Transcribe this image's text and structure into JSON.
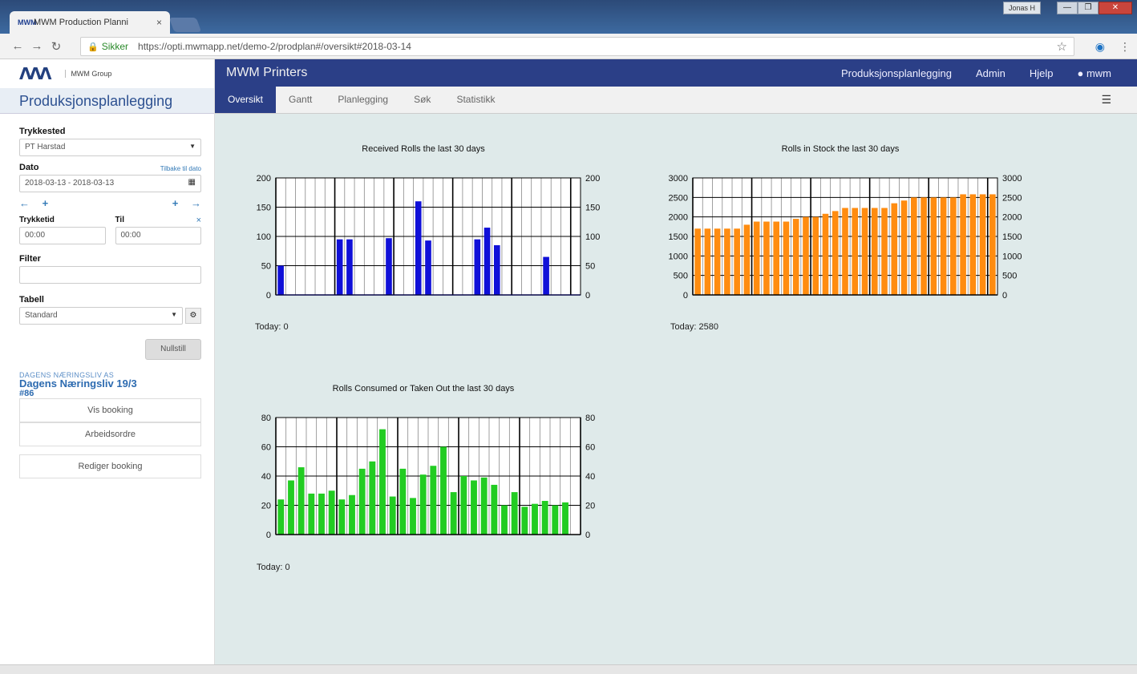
{
  "browser": {
    "tab_title": "MWM Production Planni",
    "tab_close": "×",
    "profile": "Jonas H",
    "secure_label": "Sikker",
    "url": "https://opti.mwmapp.net/demo-2/prodplan#/oversikt#2018-03-14",
    "back": "←",
    "forward": "→",
    "reload": "↻",
    "star": "☆",
    "menu": "⋮",
    "lock_icon": "🔒",
    "min": "—",
    "max": "❐",
    "close": "✕"
  },
  "sidebar": {
    "logo_mark": "MWM",
    "logo_sub": "MWM Group",
    "app_title": "Produksjonsplanlegging",
    "trykkested_label": "Trykkested",
    "trykkested_value": "PT Harstad",
    "dato_label": "Dato",
    "dato_link": "Tilbake til dato",
    "dato_value": "2018-03-13 - 2018-03-13",
    "arrow_left": "←",
    "plus_left": "+",
    "plus_right": "+",
    "arrow_right": "→",
    "trykkeltid_label": "Trykketid",
    "til_label": "Til",
    "trykkeltid_value": "00:00",
    "til_value": "00:00",
    "clear": "×",
    "filter_label": "Filter",
    "filter_value": "",
    "tabell_label": "Tabell",
    "tabell_value": "Standard",
    "gear": "⚙",
    "nullstill": "Nullstill",
    "booking_caption": "DAGENS NÆRINGSLIV AS",
    "booking_name": "Dagens Næringsliv 19/3",
    "booking_number": "#86",
    "btn_vis_booking": "Vis booking",
    "btn_arbeidsordre": "Arbeidsordre",
    "btn_rediger": "Rediger booking"
  },
  "topnav": {
    "brand": "MWM Printers",
    "links": [
      "Produksjonsplanlegging",
      "Admin",
      "Hjelp",
      "mwm"
    ],
    "user_icon": "👤"
  },
  "subnav": {
    "tabs": [
      "Oversikt",
      "Gantt",
      "Planlegging",
      "Søk",
      "Statistikk"
    ],
    "menu_icon": "☰"
  },
  "charts": {
    "received_today": "Today: 0",
    "stock_today": "Today: 2580",
    "consumed_today": "Today: 0"
  },
  "chart_data": [
    {
      "type": "bar",
      "title": "Received Rolls the last 30 days",
      "color": "#1010d8",
      "ylim": [
        0,
        200
      ],
      "yticks": [
        0,
        50,
        100,
        150,
        200
      ],
      "values": [
        50,
        0,
        0,
        0,
        0,
        0,
        95,
        95,
        0,
        0,
        0,
        97,
        0,
        0,
        160,
        93,
        0,
        0,
        0,
        0,
        95,
        115,
        85,
        0,
        0,
        0,
        0,
        65,
        0,
        0,
        0
      ],
      "grid": true
    },
    {
      "type": "bar",
      "title": "Rolls in Stock the last 30 days",
      "color": "#ff8c10",
      "ylim": [
        0,
        3000
      ],
      "yticks": [
        0,
        500,
        1000,
        1500,
        2000,
        2500,
        3000
      ],
      "values": [
        1700,
        1700,
        1700,
        1700,
        1700,
        1800,
        1880,
        1880,
        1880,
        1880,
        1950,
        2000,
        2000,
        2080,
        2150,
        2230,
        2230,
        2230,
        2230,
        2230,
        2350,
        2420,
        2500,
        2500,
        2500,
        2500,
        2500,
        2580,
        2580,
        2580,
        2580
      ],
      "grid": true
    },
    {
      "type": "bar",
      "title": "Rolls Consumed or Taken Out the last 30 days",
      "color": "#22cc22",
      "ylim": [
        0,
        80
      ],
      "yticks": [
        0,
        20,
        40,
        60,
        80
      ],
      "values": [
        24,
        37,
        46,
        28,
        28,
        30,
        24,
        27,
        45,
        50,
        72,
        26,
        45,
        25,
        41,
        47,
        60,
        29,
        40,
        37,
        39,
        34,
        20,
        29,
        19,
        21,
        23,
        20,
        22,
        0
      ],
      "grid": true
    }
  ]
}
